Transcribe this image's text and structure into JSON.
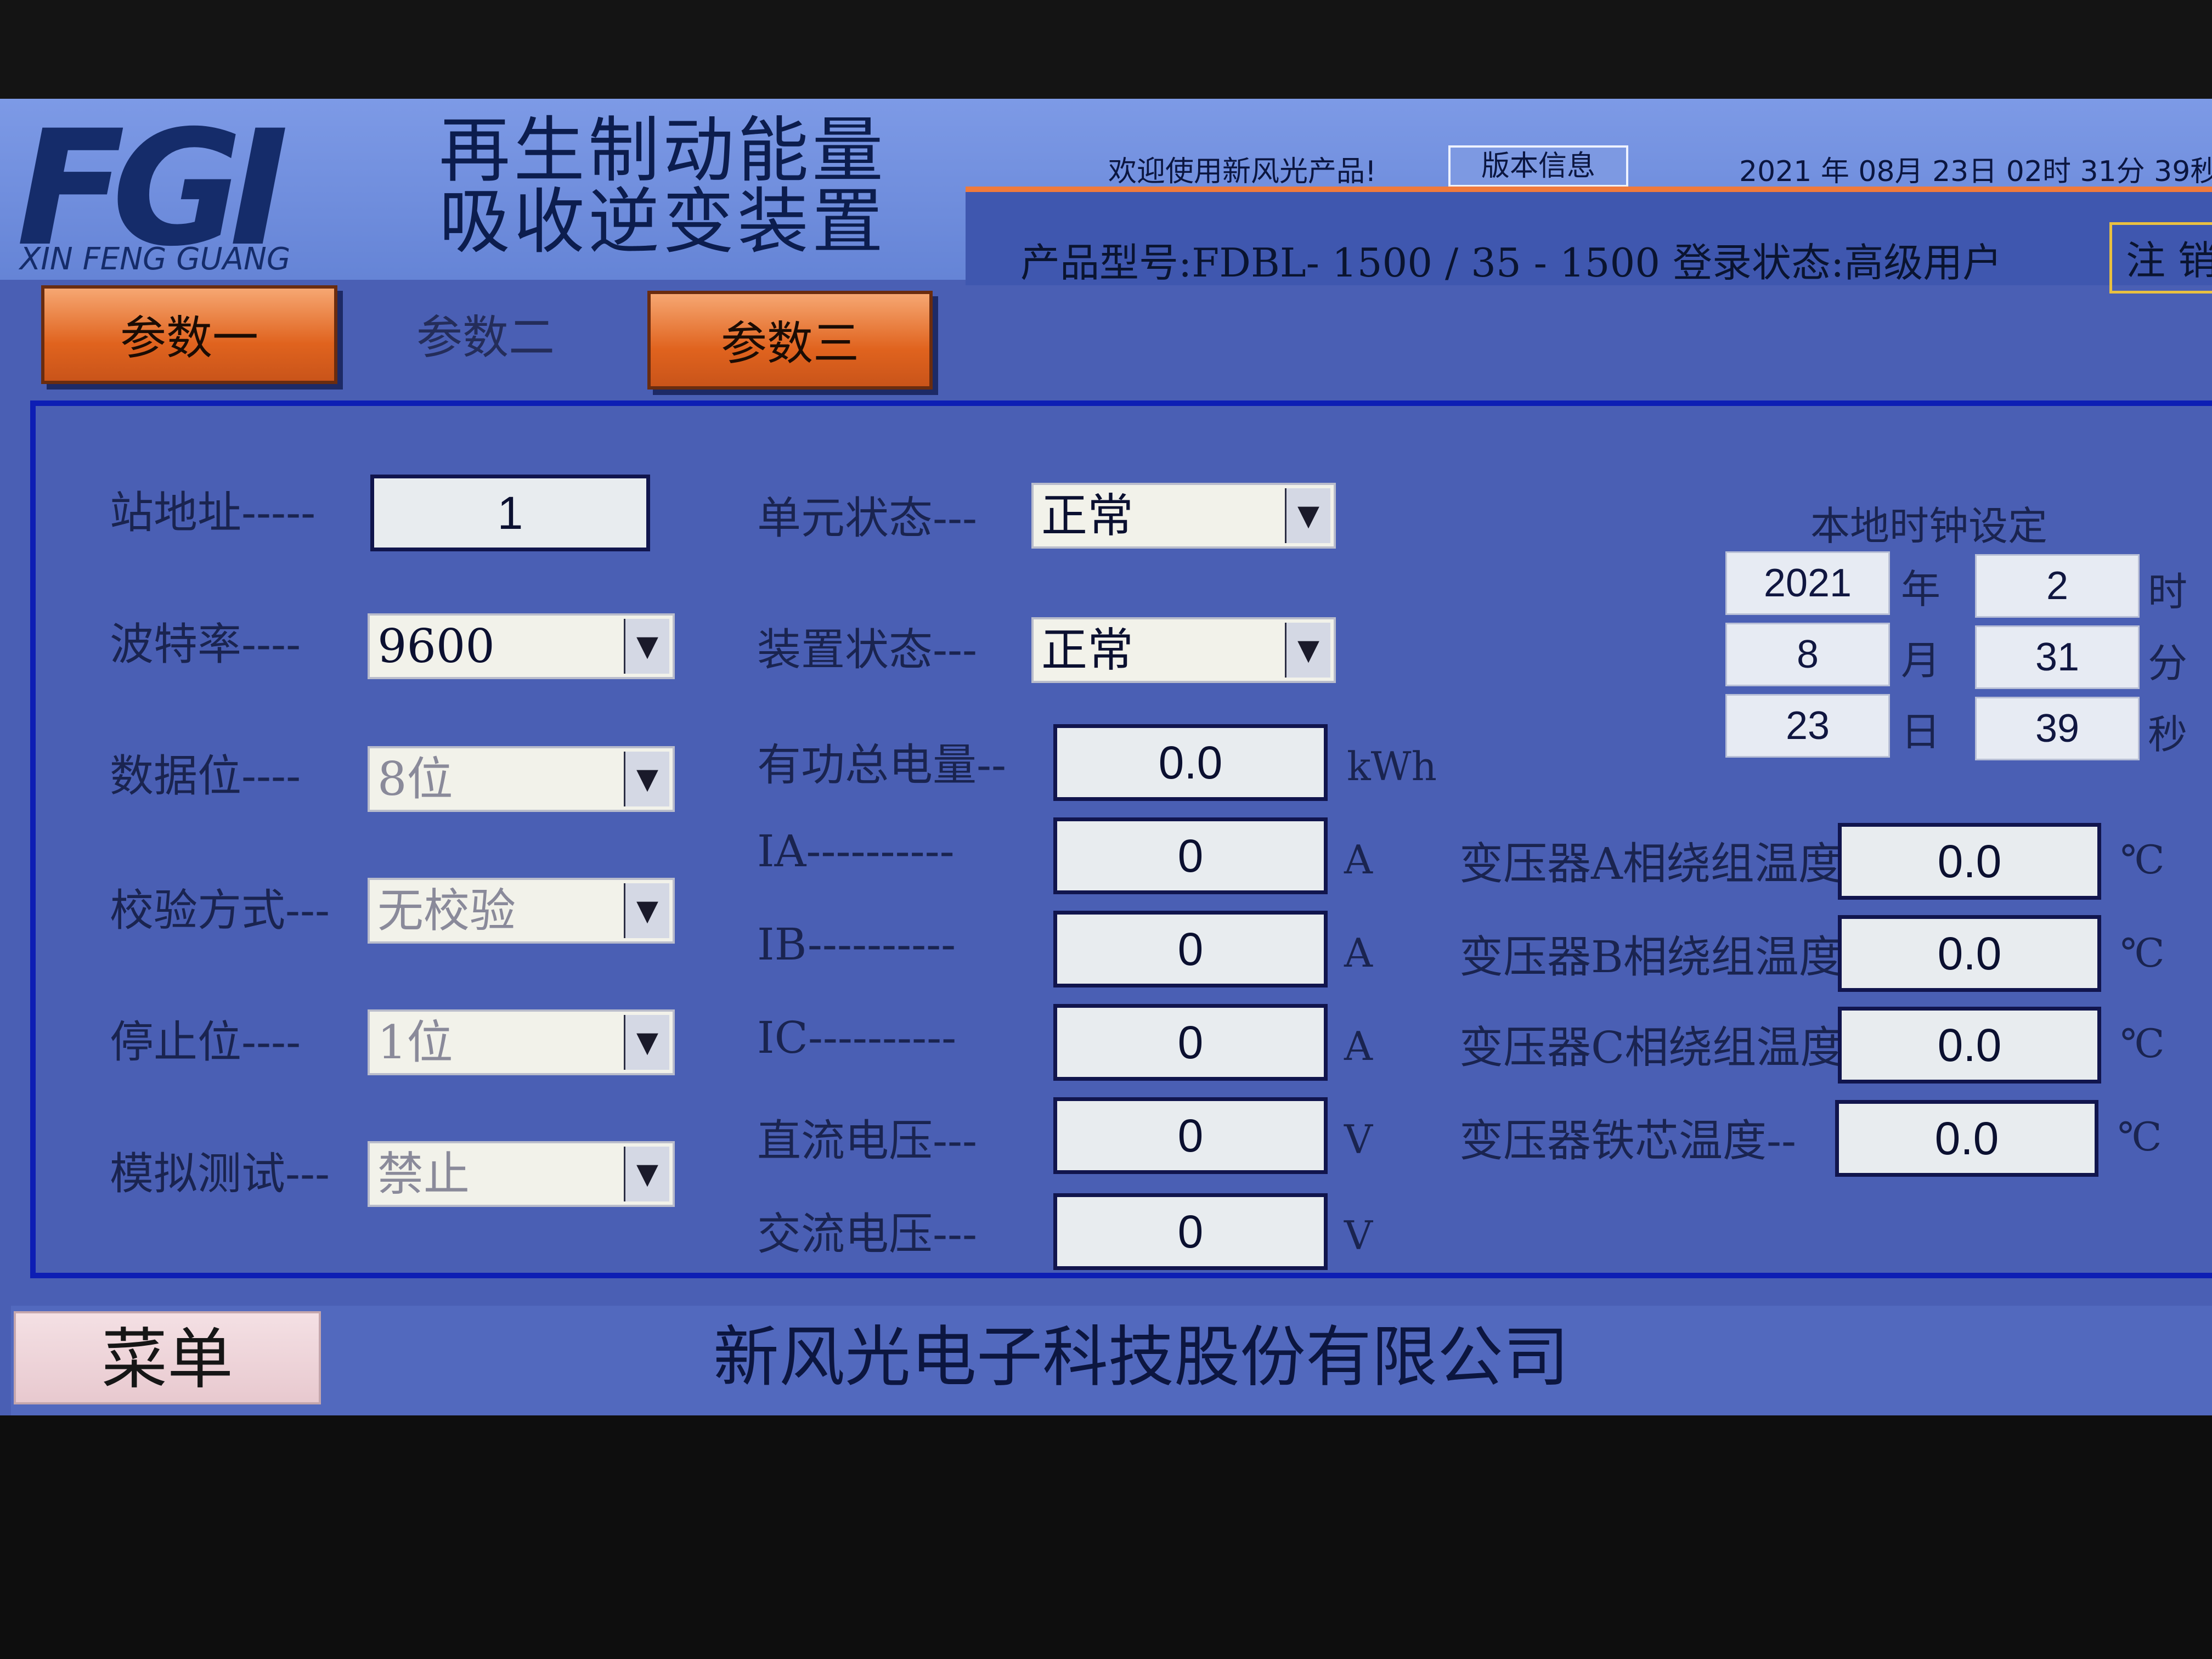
{
  "header": {
    "logo_mark": "FGI",
    "logo_sub": "XIN FENG GUANG",
    "title_line1": "再生制动能量",
    "title_line2": "吸收逆变装置",
    "welcome": "欢迎使用新风光产品!",
    "version_button": "版本信息",
    "datetime": "2021 年 08月 23日 02时 31分 39秒",
    "info_line": "产品型号:FDBL- 1500 /  35  - 1500 登录状态:高级用户",
    "logout_button": "注 销"
  },
  "tabs": [
    {
      "label": "参数一",
      "active": false
    },
    {
      "label": "参数二",
      "active": true
    },
    {
      "label": "参数三",
      "active": false
    }
  ],
  "comm": {
    "station_address": {
      "label": "站地址-----",
      "value": "1"
    },
    "baud_rate": {
      "label": "波特率----",
      "value": "9600"
    },
    "data_bits": {
      "label": "数据位----",
      "value": "8位"
    },
    "parity": {
      "label": "校验方式---",
      "value": "无校验"
    },
    "stop_bits": {
      "label": "停止位----",
      "value": "1位"
    },
    "sim_test": {
      "label": "模拟测试---",
      "value": "禁止"
    }
  },
  "status": {
    "unit_status": {
      "label": "单元状态---",
      "value": "正常"
    },
    "device_status": {
      "label": "装置状态---",
      "value": "正常"
    }
  },
  "measurements": [
    {
      "key": "active_energy",
      "label": "有功总电量--",
      "value": "0.0",
      "unit": "kWh"
    },
    {
      "key": "ia",
      "label": "IA----------",
      "value": "0",
      "unit": "A"
    },
    {
      "key": "ib",
      "label": "IB----------",
      "value": "0",
      "unit": "A"
    },
    {
      "key": "ic",
      "label": "IC----------",
      "value": "0",
      "unit": "A"
    },
    {
      "key": "dc_voltage",
      "label": "直流电压---",
      "value": "0",
      "unit": "V"
    },
    {
      "key": "ac_voltage",
      "label": "交流电压---",
      "value": "0",
      "unit": "V"
    }
  ],
  "clock": {
    "title": "本地时钟设定",
    "year": {
      "value": "2021",
      "unit": "年"
    },
    "month": {
      "value": "8",
      "unit": "月"
    },
    "day": {
      "value": "23",
      "unit": "日"
    },
    "hour": {
      "value": "2",
      "unit": "时"
    },
    "minute": {
      "value": "31",
      "unit": "分"
    },
    "second": {
      "value": "39",
      "unit": "秒"
    }
  },
  "temperatures": [
    {
      "label": "变压器A相绕组温度",
      "value": "0.0",
      "unit": "℃"
    },
    {
      "label": "变压器B相绕组温度",
      "value": "0.0",
      "unit": "℃"
    },
    {
      "label": "变压器C相绕组温度",
      "value": "0.0",
      "unit": "℃"
    },
    {
      "label": "变压器铁芯温度--",
      "value": "0.0",
      "unit": "℃"
    }
  ],
  "footer": {
    "menu_button": "菜单",
    "company": "新风光电子科技股份有限公司"
  },
  "colors": {
    "screen_bg": "#4a5fb4",
    "header_bg": "#7d9ae6",
    "tab_orange": "#e0631e",
    "panel_border": "#0d1eb4",
    "field_bg": "#e8ecef"
  }
}
